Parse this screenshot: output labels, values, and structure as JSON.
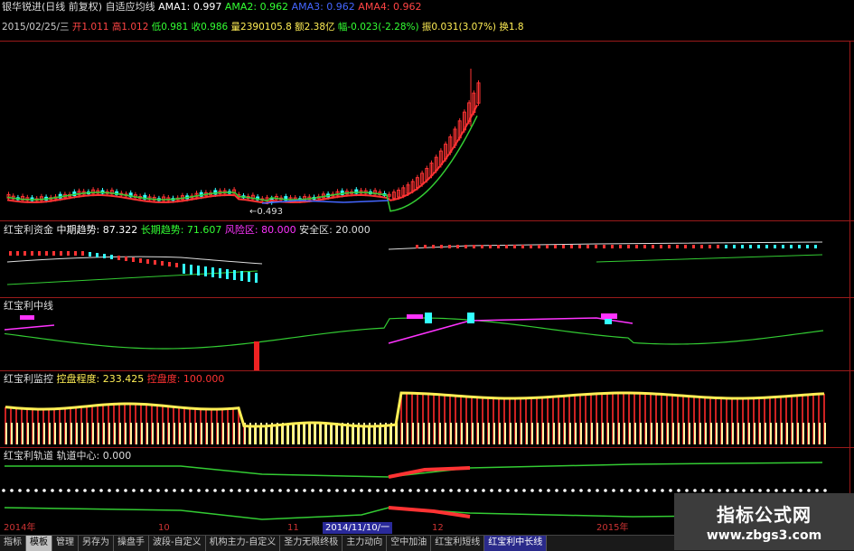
{
  "header": {
    "title": "银华锐进(日线 前复权)",
    "indicator": "自适应均线",
    "ama1": "AMA1: 0.997",
    "ama2": "AMA2: 0.962",
    "ama3": "AMA3: 0.962",
    "ama4": "AMA4: 0.962"
  },
  "info": {
    "date": "2015/02/25/三",
    "open": "开1.011",
    "high": "高1.012",
    "low": "低0.981",
    "close": "收0.986",
    "volume": "量2390105.8",
    "amount": "额2.38亿",
    "change": "幅-0.023(-2.28%)",
    "amplitude": "振0.031(3.07%)",
    "turnover": "换1.8"
  },
  "price_panel": {
    "low_label": "0.493",
    "low_label_prefix": "←"
  },
  "panel2": {
    "name": "红宝利资金",
    "mid": "中期趋势: 87.322",
    "long": "长期趋势: 71.607",
    "risk": "风险区: 80.000",
    "safe": "安全区: 20.000"
  },
  "panel3": {
    "name": "红宝利中线"
  },
  "panel4": {
    "name": "红宝利监控",
    "control": "控盘程度: 233.425",
    "control_max": "控盘度: 100.000"
  },
  "panel5": {
    "name": "红宝利轨道",
    "center": "轨道中心: 0.000"
  },
  "dates": {
    "d1": "2014年",
    "d2": "10",
    "d3": "11",
    "d4": "2014/11/10/一",
    "d5": "12",
    "d6": "2015年"
  },
  "tabs": [
    "指标",
    "模板",
    "管理",
    "另存为",
    "操盘手",
    "波段-自定义",
    "机构主力-自定义",
    "圣力无限终极",
    "主力动向",
    "空中加油",
    "红宝利短线",
    "红宝利中长线"
  ],
  "watermark": {
    "line1": "指标公式网",
    "line2": "www.zbgs3.com"
  },
  "colors": {
    "up": "#ff3333",
    "down": "#33ffff",
    "border": "#9a1a1a",
    "yellow": "#ffee55",
    "magenta": "#ff33ff",
    "green": "#33cc33"
  }
}
